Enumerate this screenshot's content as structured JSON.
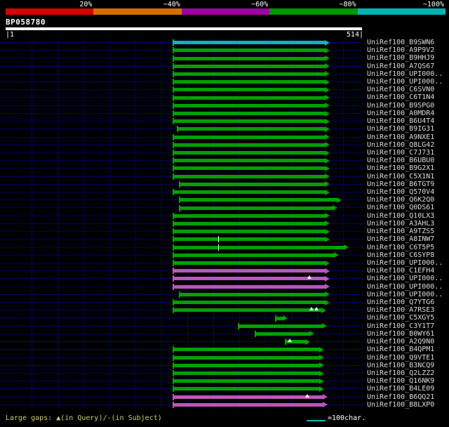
{
  "chart_data": {
    "type": "bar",
    "subtype": "alignment-span-overview",
    "title": "BP058780",
    "x_range": [
      1,
      514
    ],
    "grid": true,
    "color_legend": {
      "labels": [
        "20%",
        "~40%",
        "~60%",
        "~80%",
        "~100%"
      ],
      "colors": [
        "#d40000",
        "#d07000",
        "#a000a0",
        "#009600",
        "#00b4b4"
      ]
    },
    "hits": [
      {
        "id": "UniRef100_B9SWN6",
        "c": "cyan",
        "s": 242,
        "e": 460
      },
      {
        "id": "UniRef100_A9P9V2",
        "c": "green",
        "s": 242,
        "e": 460
      },
      {
        "id": "UniRef100_B9HHJ9",
        "c": "green",
        "s": 242,
        "e": 460
      },
      {
        "id": "UniRef100_A7QS67",
        "c": "green",
        "s": 242,
        "e": 460
      },
      {
        "id": "UniRef100_UPI000..",
        "c": "green",
        "s": 242,
        "e": 460
      },
      {
        "id": "UniRef100_UPI000..",
        "c": "green",
        "s": 242,
        "e": 460
      },
      {
        "id": "UniRef100_C6SVN0",
        "c": "green",
        "s": 242,
        "e": 460
      },
      {
        "id": "UniRef100_C6T1N4",
        "c": "green",
        "s": 242,
        "e": 460
      },
      {
        "id": "UniRef100_B9SPG0",
        "c": "green",
        "s": 242,
        "e": 460
      },
      {
        "id": "UniRef100_A0MDR4",
        "c": "green",
        "s": 242,
        "e": 460
      },
      {
        "id": "UniRef100_B6U4T4",
        "c": "green",
        "s": 242,
        "e": 460
      },
      {
        "id": "UniRef100_B9IG31",
        "c": "green",
        "s": 248,
        "e": 460
      },
      {
        "id": "UniRef100_A9NXE1",
        "c": "green",
        "s": 242,
        "e": 460
      },
      {
        "id": "UniRef100_Q8LG42",
        "c": "green",
        "s": 242,
        "e": 460
      },
      {
        "id": "UniRef100_C7J731",
        "c": "green",
        "s": 242,
        "e": 460
      },
      {
        "id": "UniRef100_B6UBU0",
        "c": "green",
        "s": 242,
        "e": 460
      },
      {
        "id": "UniRef100_B9G2X1",
        "c": "green",
        "s": 242,
        "e": 460
      },
      {
        "id": "UniRef100_C5X1N1",
        "c": "green",
        "s": 242,
        "e": 460
      },
      {
        "id": "UniRef100_B6TGT9",
        "c": "green",
        "s": 251,
        "e": 460
      },
      {
        "id": "UniRef100_Q570V4",
        "c": "green",
        "s": 242,
        "e": 460
      },
      {
        "id": "UniRef100_Q6K2Q0",
        "c": "green",
        "s": 251,
        "e": 478
      },
      {
        "id": "UniRef100_Q0DS61",
        "c": "green",
        "s": 251,
        "e": 472
      },
      {
        "id": "UniRef100_Q10LX3",
        "c": "green",
        "s": 242,
        "e": 460
      },
      {
        "id": "UniRef100_A3AHL3",
        "c": "green",
        "s": 242,
        "e": 460
      },
      {
        "id": "UniRef100_A9TZS5",
        "c": "green",
        "s": 242,
        "e": 460
      },
      {
        "id": "UniRef100_A8INW7",
        "c": "green",
        "s": 242,
        "e": 460,
        "marks": [
          {
            "t": "sgap",
            "p": 310
          }
        ]
      },
      {
        "id": "UniRef100_C6T5P5",
        "c": "green",
        "s": 242,
        "e": 488,
        "marks": [
          {
            "t": "sgap",
            "p": 310
          }
        ]
      },
      {
        "id": "UniRef100_C6SYP8",
        "c": "green",
        "s": 242,
        "e": 474
      },
      {
        "id": "UniRef100_UPI000..",
        "c": "green",
        "s": 242,
        "e": 460
      },
      {
        "id": "UniRef100_C1EFH4",
        "c": "magenta",
        "s": 242,
        "e": 460
      },
      {
        "id": "UniRef100_UPI000..",
        "c": "magenta",
        "s": 242,
        "e": 460,
        "marks": [
          {
            "t": "qgap",
            "p": 438
          }
        ]
      },
      {
        "id": "UniRef100_UPI000..",
        "c": "magenta",
        "s": 242,
        "e": 460
      },
      {
        "id": "UniRef100_UPI000..",
        "c": "green",
        "s": 251,
        "e": 460
      },
      {
        "id": "UniRef100_Q7YTG6",
        "c": "green",
        "s": 242,
        "e": 460
      },
      {
        "id": "UniRef100_A7RSE3",
        "c": "green",
        "s": 242,
        "e": 455,
        "marks": [
          {
            "t": "qgap",
            "p": 441
          },
          {
            "t": "qgap",
            "p": 448
          }
        ]
      },
      {
        "id": "UniRef100_C5XGY5",
        "c": "green",
        "s": 390,
        "e": 400
      },
      {
        "id": "UniRef100_C3Y1T7",
        "c": "green",
        "s": 336,
        "e": 456
      },
      {
        "id": "UniRef100_B0WY61",
        "c": "green",
        "s": 360,
        "e": 438
      },
      {
        "id": "UniRef100_A2Q9N0",
        "c": "green",
        "s": 404,
        "e": 432,
        "marks": [
          {
            "t": "qgap",
            "p": 410
          }
        ]
      },
      {
        "id": "UniRef100_B4QPM1",
        "c": "green",
        "s": 242,
        "e": 452
      },
      {
        "id": "UniRef100_Q9VTE1",
        "c": "green",
        "s": 242,
        "e": 452
      },
      {
        "id": "UniRef100_B3NCQ9",
        "c": "green",
        "s": 242,
        "e": 452
      },
      {
        "id": "UniRef100_Q2LZZ2",
        "c": "green",
        "s": 242,
        "e": 452
      },
      {
        "id": "UniRef100_Q16NK9",
        "c": "green",
        "s": 242,
        "e": 452
      },
      {
        "id": "UniRef100_B4LE09",
        "c": "green",
        "s": 242,
        "e": 452
      },
      {
        "id": "UniRef100_B6QQ21",
        "c": "magenta",
        "s": 242,
        "e": 457,
        "marks": [
          {
            "t": "qgap",
            "p": 435
          }
        ]
      },
      {
        "id": "UniRef100_B8LXP0",
        "c": "magenta",
        "s": 242,
        "e": 457
      }
    ]
  },
  "query": {
    "name": "BP058780",
    "ruler_start_label": "|1",
    "ruler_end_label": "514|",
    "length": 514
  },
  "legend": {
    "gaps_text": "Large gaps: ▲(in Query)/-(in Subject)",
    "scale_text": "=100char."
  },
  "bar_colors": {
    "green": "#00a000",
    "magenta": "#bb55bb",
    "cyan": "#00b7b7"
  }
}
